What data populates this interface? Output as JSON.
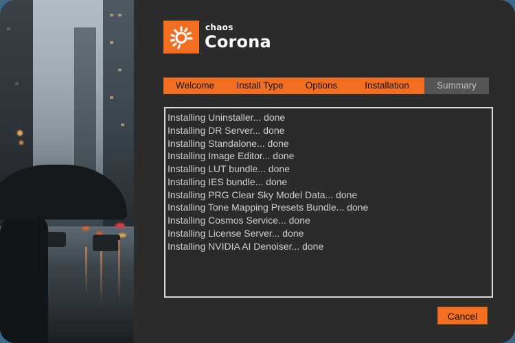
{
  "brand": {
    "company": "chaos",
    "product": "Corona",
    "logo_color": "#f26f22"
  },
  "tabs": [
    {
      "label": "Welcome",
      "state": "completed"
    },
    {
      "label": "Install Type",
      "state": "completed"
    },
    {
      "label": "Options",
      "state": "completed"
    },
    {
      "label": "Installation",
      "state": "active"
    },
    {
      "label": "Summary",
      "state": "pending"
    }
  ],
  "log": {
    "lines": [
      "Installing Uninstaller... done",
      "Installing DR Server... done",
      "Installing Standalone... done",
      "Installing Image Editor... done",
      "Installing LUT bundle... done",
      "Installing IES bundle... done",
      "Installing PRG Clear Sky Model Data... done",
      "Installing Tone Mapping Presets Bundle... done",
      "Installing Cosmos Service... done",
      "Installing License Server... done",
      "Installing NVIDIA AI Denoiser... done"
    ]
  },
  "footer": {
    "cancel_label": "Cancel"
  },
  "colors": {
    "accent": "#f26f22",
    "background": "#2b2b2b",
    "inactive_tab": "#555555"
  }
}
